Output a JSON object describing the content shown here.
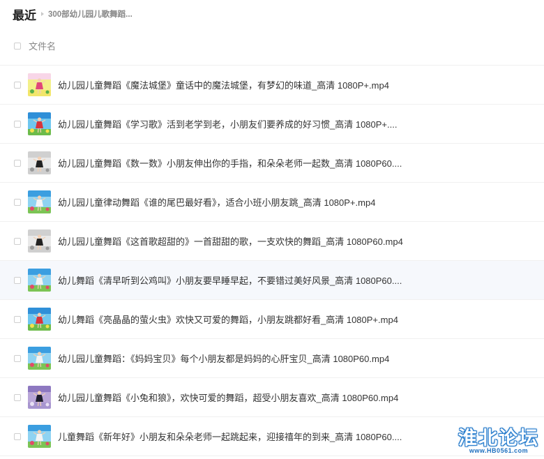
{
  "breadcrumb": {
    "root": "最近",
    "current": "300部幼儿园儿歌舞蹈..."
  },
  "header": {
    "column_name": "文件名"
  },
  "files": [
    {
      "name": "幼儿园儿童舞蹈《魔法城堡》童话中的魔法城堡，有梦幻的味道_高清 1080P+.mp4",
      "thumb": "stage-pink"
    },
    {
      "name": "幼儿园儿童舞蹈《学习歌》活到老学到老，小朋友们要养成的好习惯_高清 1080P+....",
      "thumb": "sky-red"
    },
    {
      "name": "幼儿园儿童舞蹈《数一数》小朋友伸出你的手指，和朵朵老师一起数_高清 1080P60....",
      "thumb": "gray-dark"
    },
    {
      "name": "幼儿园儿童律动舞蹈《谁的尾巴最好看》，适合小班小朋友跳_高清 1080P+.mp4",
      "thumb": "sky-white"
    },
    {
      "name": "幼儿园儿童舞蹈《这首歌超甜的》一首甜甜的歌，一支欢快的舞蹈_高清 1080P60.mp4",
      "thumb": "gray-dark"
    },
    {
      "name": "幼儿舞蹈《清早听到公鸡叫》小朋友要早睡早起，不要错过美好风景_高清 1080P60....",
      "thumb": "sky-white"
    },
    {
      "name": "幼儿舞蹈《亮晶晶的萤火虫》欢快又可爱的舞蹈，小朋友跳都好看_高清 1080P+.mp4",
      "thumb": "sky-red"
    },
    {
      "name": "幼儿园儿童舞蹈：《妈妈宝贝》每个小朋友都是妈妈的心肝宝贝_高清 1080P60.mp4",
      "thumb": "sky-white"
    },
    {
      "name": "幼儿园儿童舞蹈《小兔和狼》，欢快可爱的舞蹈，超受小朋友喜欢_高清 1080P60.mp4",
      "thumb": "purple-dark"
    },
    {
      "name": "儿童舞蹈《新年好》小朋友和朵朵老师一起跳起来，迎接禧年的到来_高清 1080P60....",
      "thumb": "sky-white"
    }
  ],
  "hover_row_index": 5,
  "watermark": {
    "title": "淮北论坛",
    "url": "www.HB0561.com"
  },
  "colors": {
    "hover_bg": "#f6f8fc",
    "divider": "#f0f0f0",
    "watermark_blue": "#1d6fbf"
  }
}
